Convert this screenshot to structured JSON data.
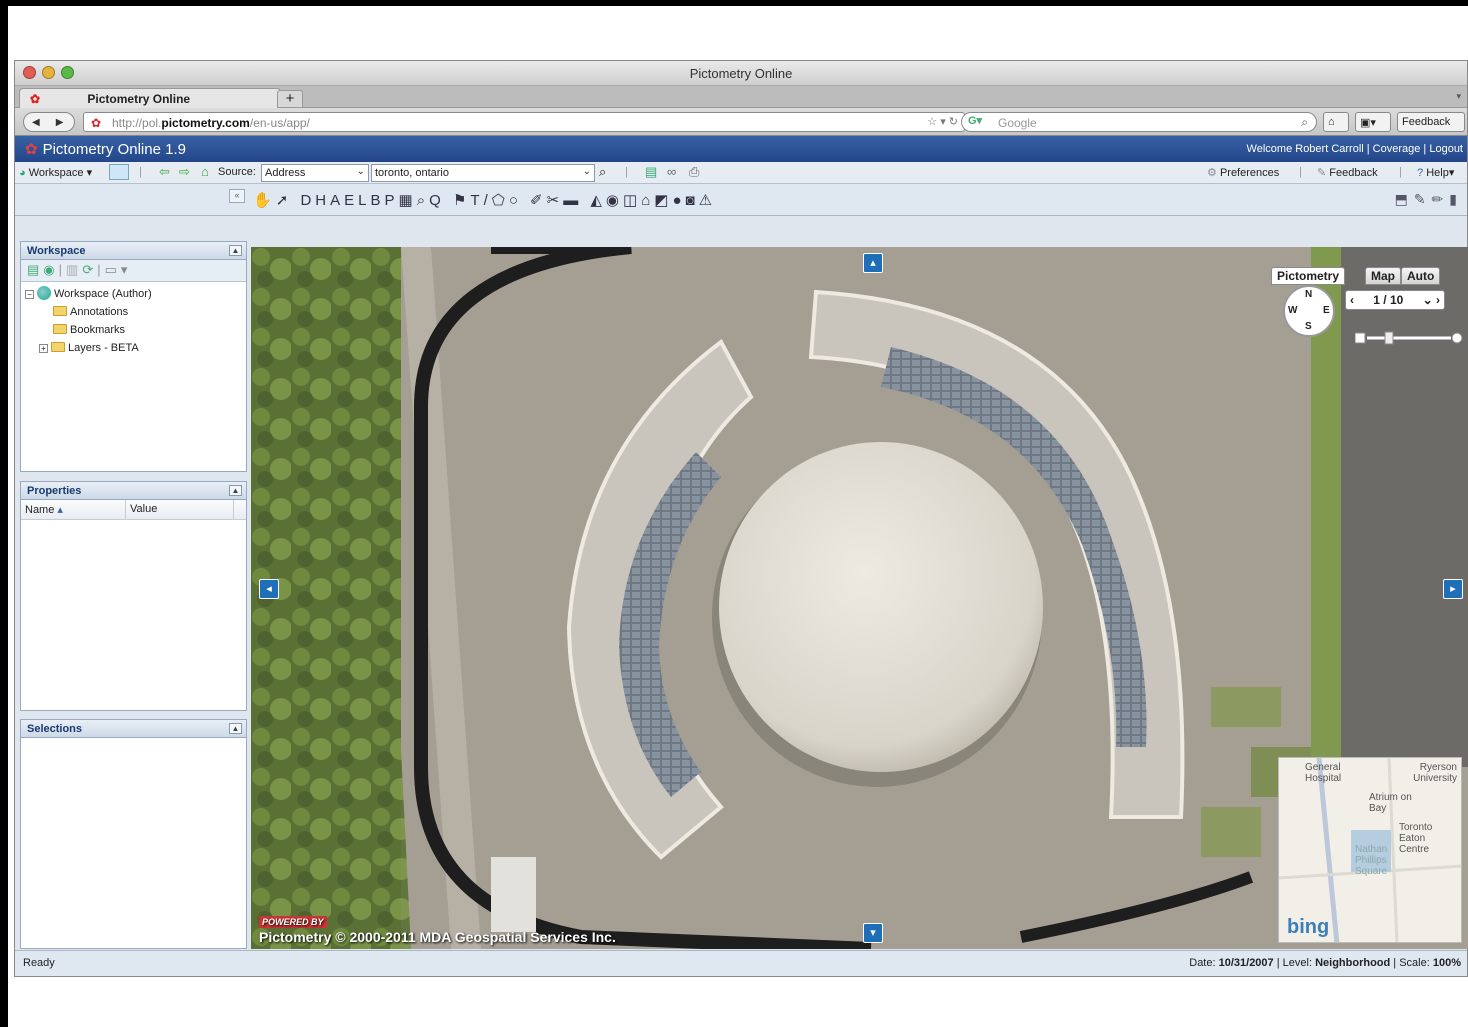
{
  "browser": {
    "window_title": "Pictometry Online",
    "tab_title": "Pictometry Online",
    "new_tab": "+",
    "url_plain": "http://pol.",
    "url_bold": "pictometry.com",
    "url_rest": "/en-us/app/",
    "search_placeholder": "Google",
    "feedback_button": "Feedback"
  },
  "app": {
    "title": "Pictometry Online 1.9",
    "welcome": "Welcome Robert Carroll | Coverage | Logout"
  },
  "toolbar": {
    "workspace": "Workspace",
    "source_label": "Source:",
    "source_value": "Address",
    "search_value": "toronto, ontario",
    "preferences": "Preferences",
    "feedback": "Feedback",
    "help": "Help"
  },
  "panels": {
    "workspace": {
      "title": "Workspace",
      "tree": [
        "Workspace (Author)",
        "Annotations",
        "Bookmarks",
        "Layers - BETA"
      ]
    },
    "properties": {
      "title": "Properties",
      "col_name": "Name",
      "col_value": "Value"
    },
    "selections": {
      "title": "Selections"
    }
  },
  "viewer": {
    "tabs": [
      "Pictometry",
      "Map",
      "Auto"
    ],
    "page": "1 / 10",
    "compass": {
      "n": "N",
      "e": "E",
      "s": "S",
      "w": "W"
    },
    "watermark_powered": "POWERED BY",
    "watermark_brand": "Pictometry",
    "copyright": "© 2000-2011 MDA Geospatial Services Inc.",
    "minimap_labels": [
      "General Hospital",
      "Ryerson University",
      "Atrium on Bay",
      "Toronto Eaton Centre",
      "Nathan Phillips Square"
    ],
    "minimap_brand": "bing"
  },
  "status": {
    "left": "Ready",
    "date_label": "Date:",
    "date": "10/31/2007",
    "level_label": "Level:",
    "level": "Neighborhood",
    "scale_label": "Scale:",
    "scale": "100%"
  },
  "colors": {
    "header_blue": "#23468a",
    "accent_red": "#d22",
    "panel_title": "#1a3a6e"
  }
}
